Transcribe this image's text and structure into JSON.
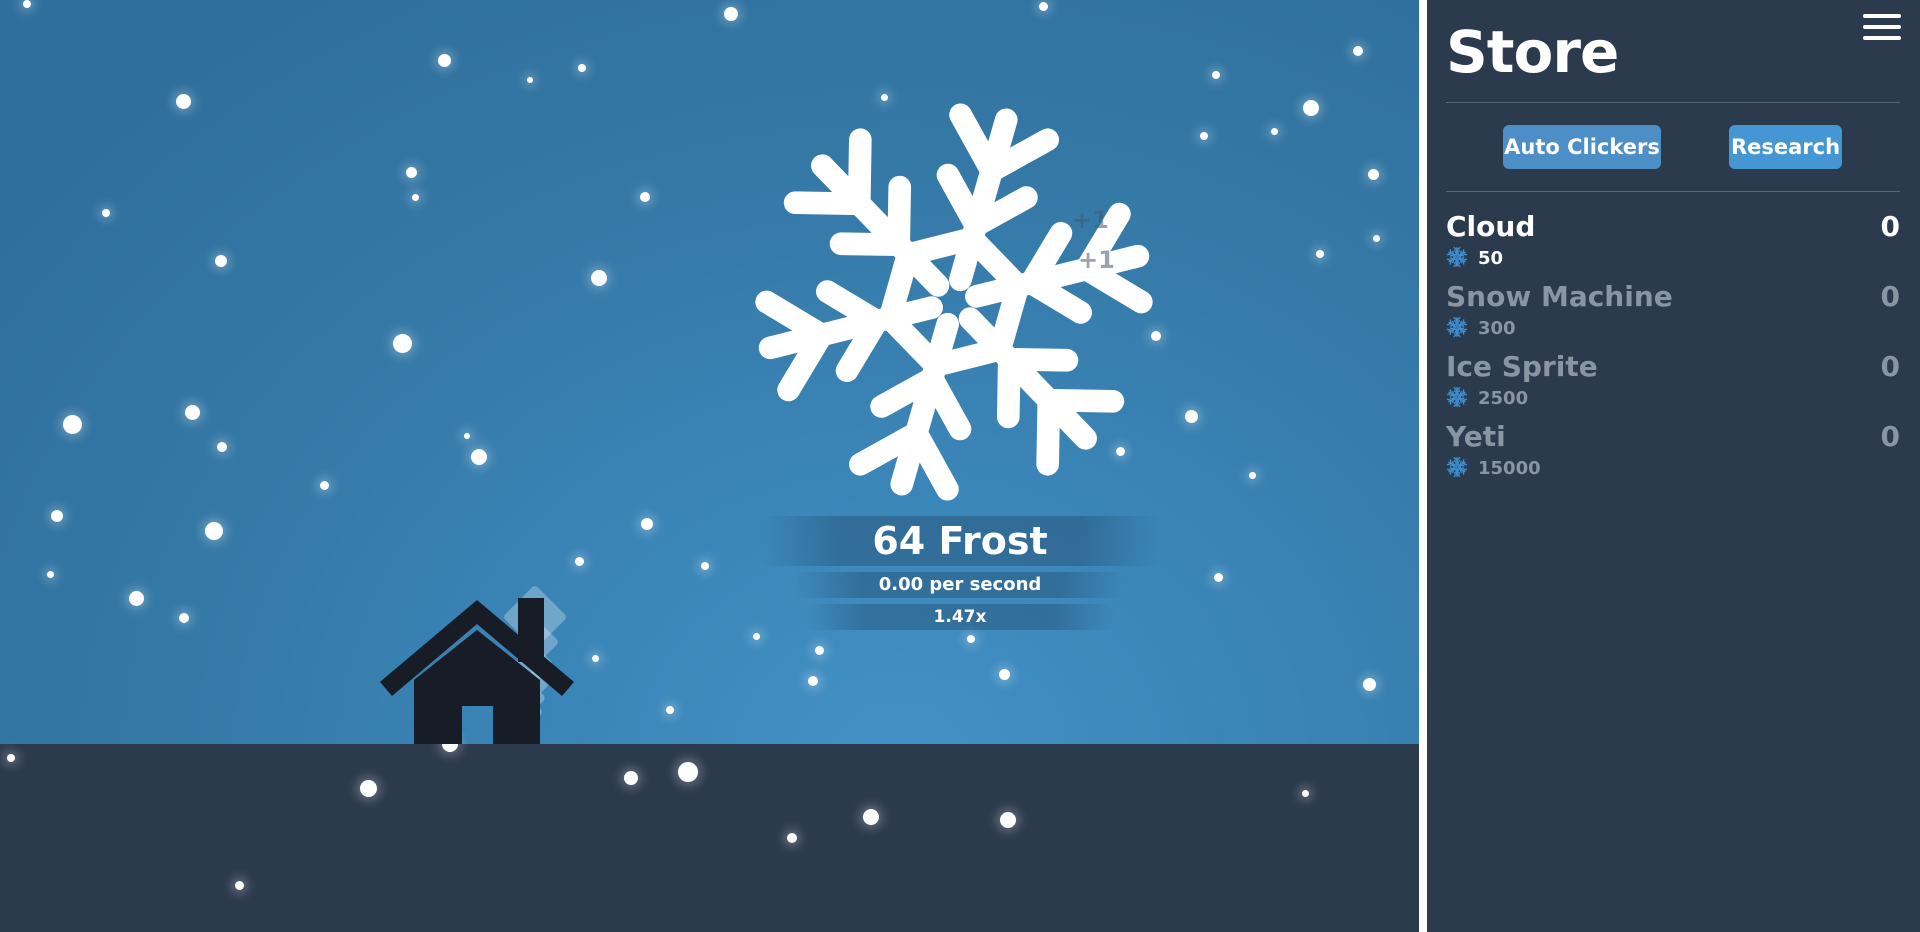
{
  "game": {
    "frost_display": "64 Frost",
    "per_second_display": "0.00 per second",
    "multiplier_display": "1.47x",
    "click_popups": [
      "+1",
      "+1"
    ]
  },
  "store": {
    "title": "Store",
    "tabs": [
      {
        "label": "Auto Clickers"
      },
      {
        "label": "Research"
      }
    ],
    "items": [
      {
        "name": "Cloud",
        "price": "50",
        "owned": "0",
        "affordable": true
      },
      {
        "name": "Snow Machine",
        "price": "300",
        "owned": "0",
        "affordable": false
      },
      {
        "name": "Ice Sprite",
        "price": "2500",
        "owned": "0",
        "affordable": false
      },
      {
        "name": "Yeti",
        "price": "15000",
        "owned": "0",
        "affordable": false
      }
    ]
  },
  "icons": {
    "main": "snowflake-icon",
    "building": "house-icon",
    "menu": "hamburger-menu-icon",
    "currency": "snowflake-icon"
  },
  "colors": {
    "sky": "#3a83b6",
    "ground": "#2c3a4d",
    "panel": "#2b3a4d",
    "button_accent": "#4597d4",
    "currency_icon": "#3f8fd0",
    "inactive_text": "#8a95a4"
  }
}
